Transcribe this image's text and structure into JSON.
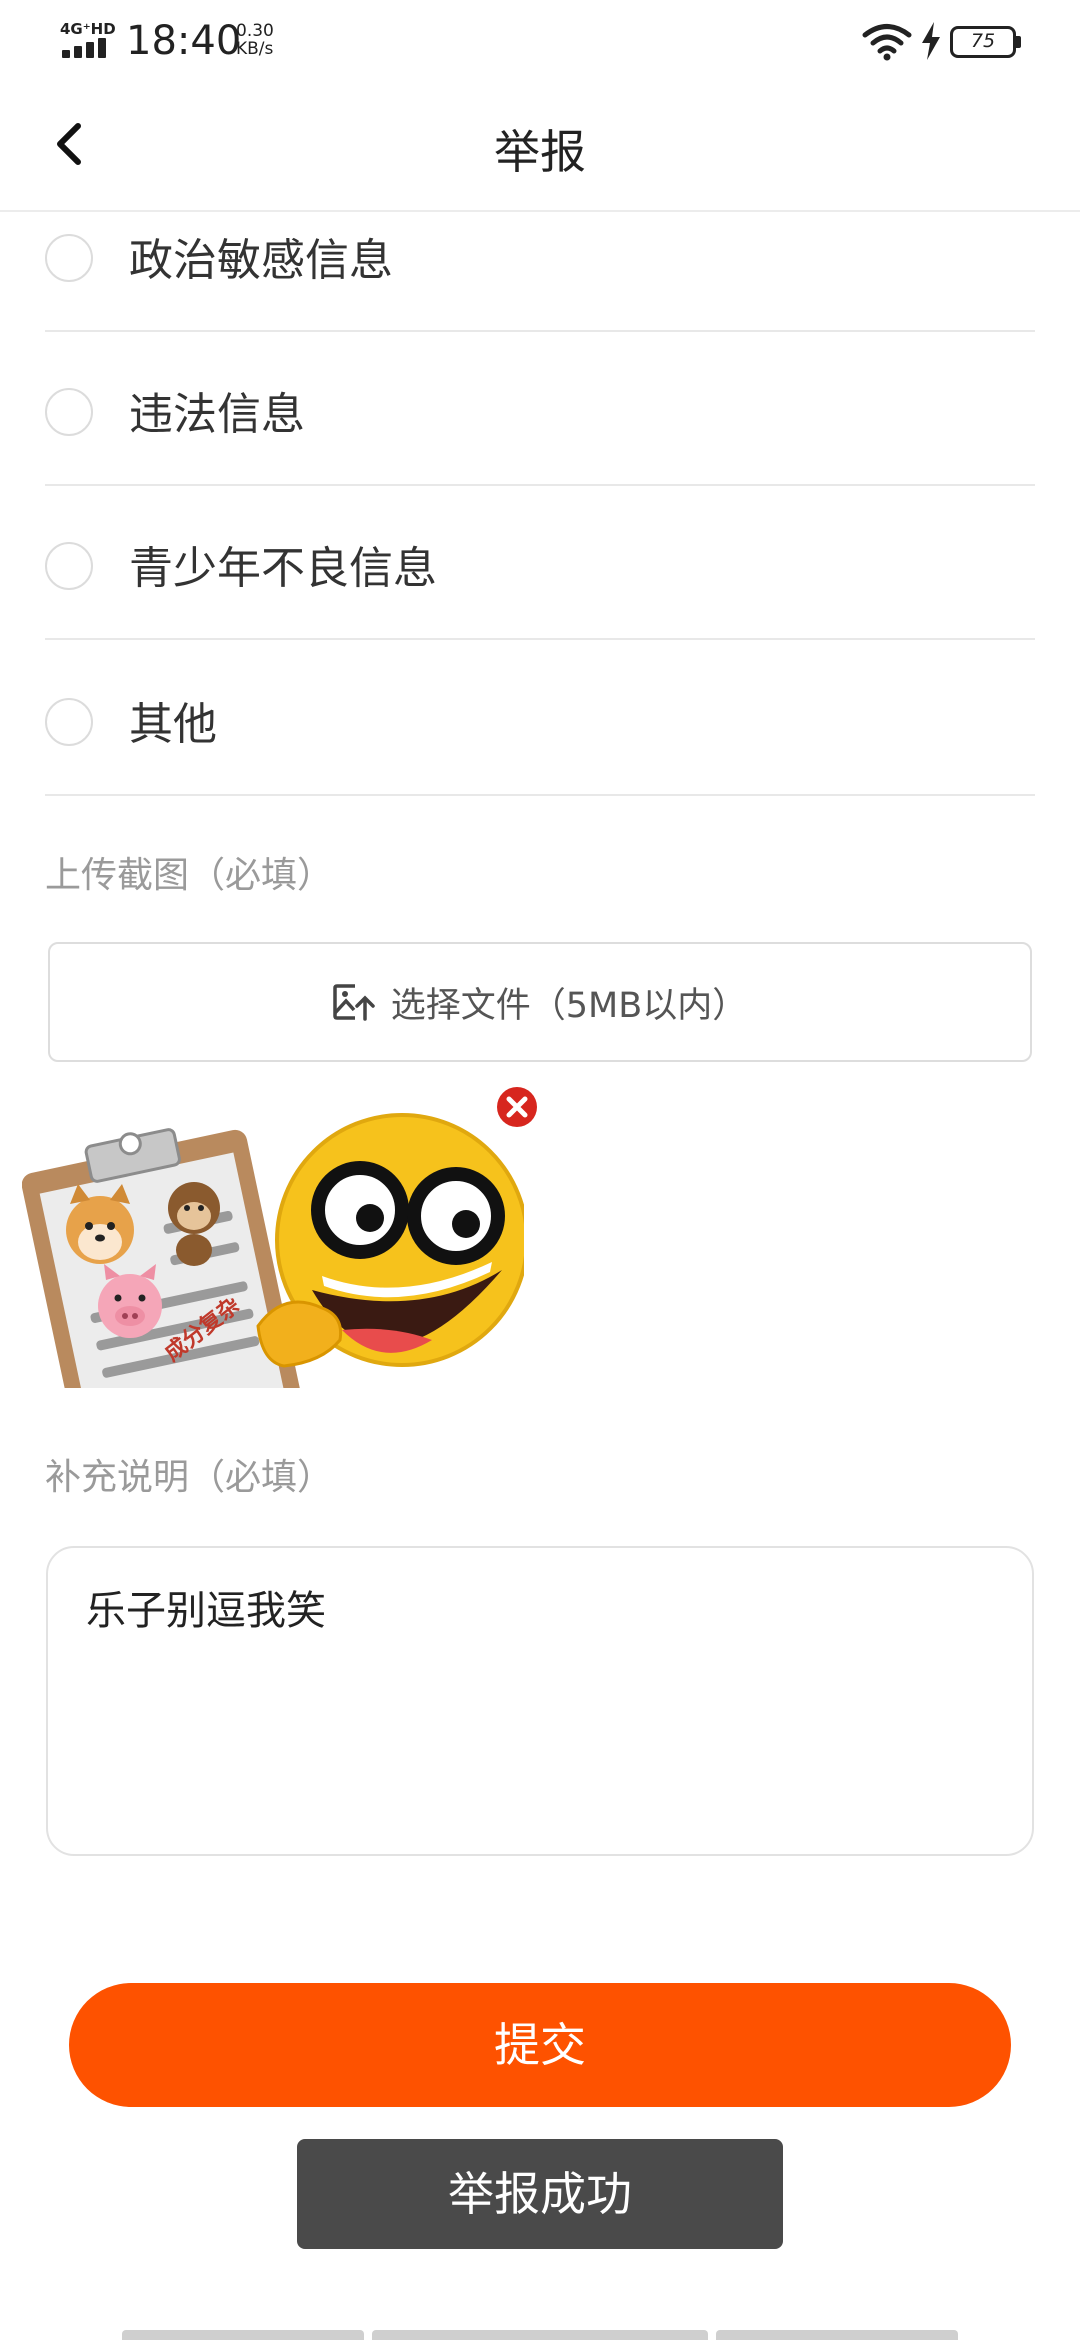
{
  "status_bar": {
    "network": "4G⁺HD",
    "time": "18:40",
    "speed_value": "0.30",
    "speed_unit": "KB/s",
    "battery": "75"
  },
  "header": {
    "title": "举报",
    "back_icon": "chevron-left-icon"
  },
  "options": [
    {
      "label": "政治敏感信息",
      "checked": false
    },
    {
      "label": "违法信息",
      "checked": false
    },
    {
      "label": "青少年不良信息",
      "checked": false
    },
    {
      "label": "其他",
      "checked": false
    }
  ],
  "upload": {
    "section_label": "上传截图（必填）",
    "button_label": "选择文件（5MB以内）",
    "button_icon": "image-upload-icon",
    "thumbnail_caption": "成分复杂",
    "remove_icon": "close-icon"
  },
  "description": {
    "section_label": "补充说明（必填）",
    "value": "乐子别逗我笑"
  },
  "submit_label": "提交",
  "toast": "举报成功",
  "colors": {
    "accent": "#fe5200",
    "toast_bg": "#4a4a4a",
    "remove": "#d7261e"
  }
}
